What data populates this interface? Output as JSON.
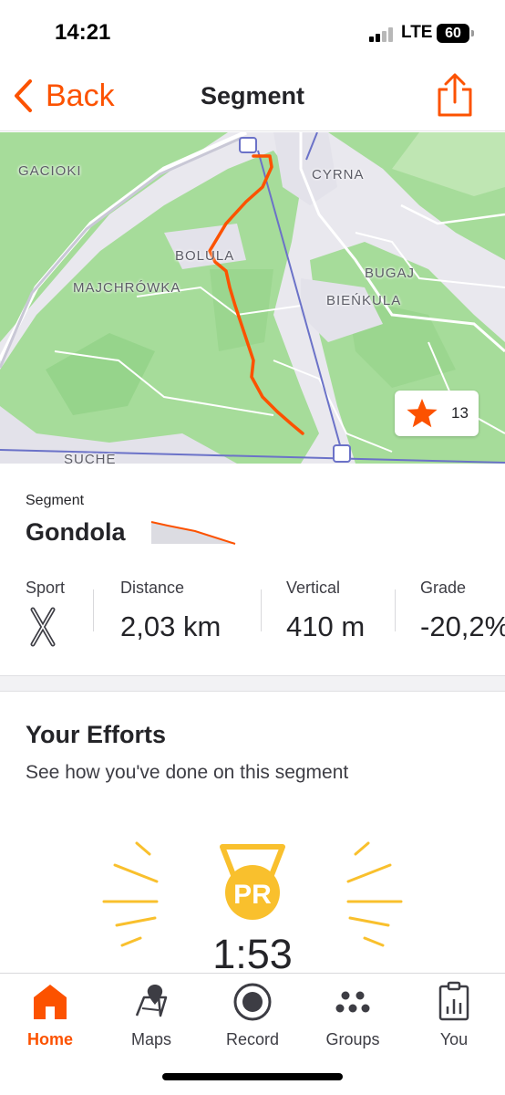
{
  "status_bar": {
    "time": "14:21",
    "network": "LTE",
    "battery": "60"
  },
  "nav": {
    "back_label": "Back",
    "title": "Segment"
  },
  "map": {
    "labels": [
      "GACIOKI",
      "CYRNA",
      "BOLULA",
      "BUGAJ",
      "MAJCHRÓWKA",
      "BIEŃKULA",
      "SUCHE"
    ],
    "favorite_count": "13",
    "route_color": "#fc5200"
  },
  "segment": {
    "label": "Segment",
    "name": "Gondola",
    "stats": {
      "sport_label": "Sport",
      "distance_label": "Distance",
      "distance_value": "2,03 km",
      "vertical_label": "Vertical",
      "vertical_value": "410 m",
      "grade_label": "Grade",
      "grade_value": "-20,2%"
    }
  },
  "efforts": {
    "title": "Your Efforts",
    "subtitle": "See how you've done on this segment",
    "pr_badge": "PR",
    "pr_time": "1:53"
  },
  "tab_bar": {
    "tabs": [
      {
        "label": "Home",
        "icon": "home-icon",
        "active": true
      },
      {
        "label": "Maps",
        "icon": "maps-icon",
        "active": false
      },
      {
        "label": "Record",
        "icon": "record-icon",
        "active": false
      },
      {
        "label": "Groups",
        "icon": "groups-icon",
        "active": false
      },
      {
        "label": "You",
        "icon": "you-icon",
        "active": false
      }
    ]
  },
  "colors": {
    "brand": "#fc5200",
    "pr_gold": "#f9c02d",
    "map_green": "#a6dc9a"
  }
}
